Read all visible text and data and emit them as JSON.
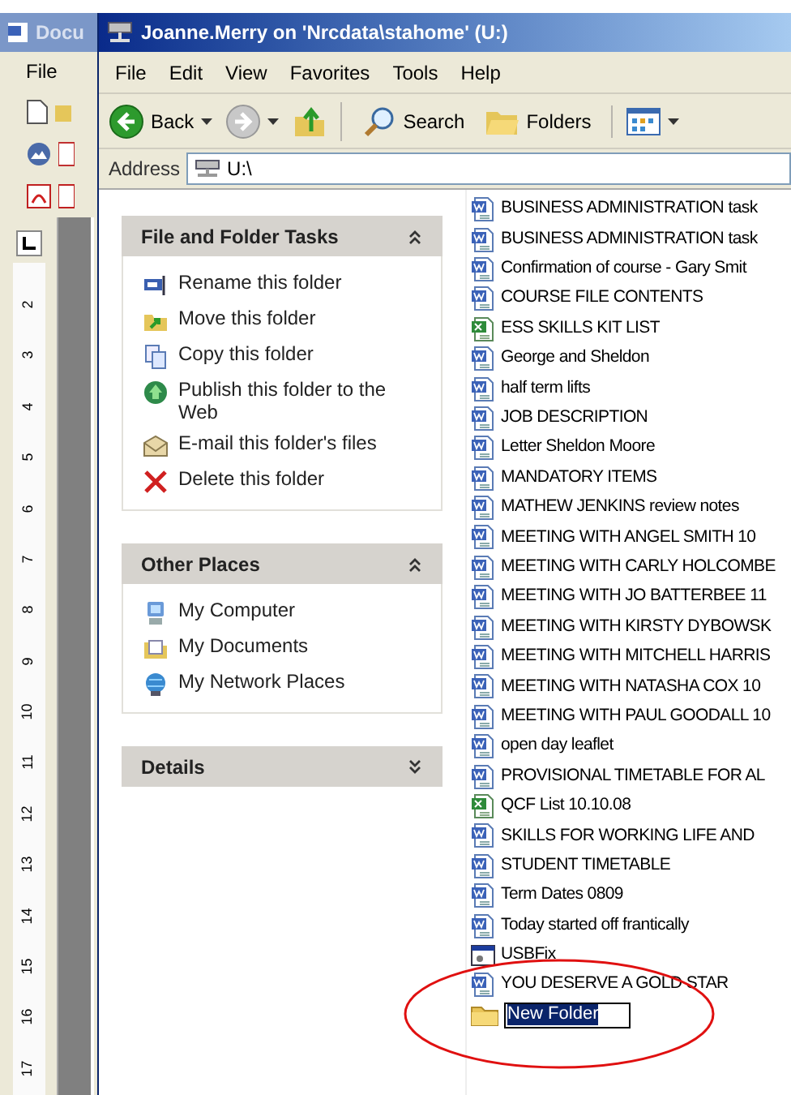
{
  "background_window": {
    "title": "Docu",
    "menu": [
      "File"
    ],
    "ruler_marks": [
      "2",
      "3",
      "4",
      "5",
      "6",
      "7",
      "8",
      "9",
      "10",
      "11",
      "12",
      "13",
      "14",
      "15",
      "16",
      "17"
    ]
  },
  "window": {
    "title": "Joanne.Merry on 'Nrcdata\\stahome' (U:)"
  },
  "menu": [
    "File",
    "Edit",
    "View",
    "Favorites",
    "Tools",
    "Help"
  ],
  "toolbar": [
    {
      "kind": "back",
      "label": "Back"
    },
    {
      "kind": "forward"
    },
    {
      "kind": "up"
    },
    {
      "kind": "search",
      "label": "Search"
    },
    {
      "kind": "folders",
      "label": "Folders"
    },
    {
      "kind": "views"
    }
  ],
  "address": {
    "label": "Address",
    "value": "U:\\"
  },
  "task_panes": [
    {
      "title": "File and Folder Tasks",
      "expanded": true,
      "items": [
        {
          "label": "Rename this folder",
          "kind": "rename"
        },
        {
          "label": "Move this folder",
          "kind": "move"
        },
        {
          "label": "Copy this folder",
          "kind": "copy"
        },
        {
          "label": "Publish this folder to the Web",
          "kind": "publish"
        },
        {
          "label": "E-mail this folder's files",
          "kind": "email"
        },
        {
          "label": "Delete this folder",
          "kind": "delete"
        }
      ]
    },
    {
      "title": "Other Places",
      "expanded": true,
      "items": [
        {
          "label": "My Computer",
          "kind": "computer"
        },
        {
          "label": "My Documents",
          "kind": "documents"
        },
        {
          "label": "My Network Places",
          "kind": "network"
        }
      ]
    },
    {
      "title": "Details",
      "expanded": false
    }
  ],
  "files": [
    {
      "name": "BUSINESS ADMINISTRATION task",
      "kind": "word",
      "editing": false
    },
    {
      "name": "BUSINESS ADMINISTRATION task",
      "kind": "word",
      "editing": false
    },
    {
      "name": "Confirmation of course - Gary Smit",
      "kind": "word",
      "editing": false
    },
    {
      "name": "COURSE FILE CONTENTS",
      "kind": "word",
      "editing": false
    },
    {
      "name": "ESS SKILLS KIT LIST",
      "kind": "excel",
      "editing": false
    },
    {
      "name": "George and Sheldon",
      "kind": "word",
      "editing": false
    },
    {
      "name": "half term lifts",
      "kind": "word",
      "editing": false
    },
    {
      "name": "JOB DESCRIPTION",
      "kind": "word",
      "editing": false
    },
    {
      "name": "Letter Sheldon Moore",
      "kind": "word",
      "editing": false
    },
    {
      "name": "MANDATORY ITEMS",
      "kind": "word",
      "editing": false
    },
    {
      "name": "MATHEW JENKINS review notes",
      "kind": "word",
      "editing": false
    },
    {
      "name": "MEETING WITH ANGEL SMITH 10",
      "kind": "word",
      "editing": false
    },
    {
      "name": "MEETING WITH CARLY HOLCOMBE",
      "kind": "word",
      "editing": false
    },
    {
      "name": "MEETING WITH JO BATTERBEE 11",
      "kind": "word",
      "editing": false
    },
    {
      "name": "MEETING WITH KIRSTY DYBOWSK",
      "kind": "word",
      "editing": false
    },
    {
      "name": "MEETING WITH MITCHELL HARRIS",
      "kind": "word",
      "editing": false
    },
    {
      "name": "MEETING WITH NATASHA COX 10",
      "kind": "word",
      "editing": false
    },
    {
      "name": "MEETING WITH PAUL GOODALL 10",
      "kind": "word",
      "editing": false
    },
    {
      "name": "open day leaflet",
      "kind": "word",
      "editing": false
    },
    {
      "name": "PROVISIONAL TIMETABLE FOR AL",
      "kind": "word",
      "editing": false
    },
    {
      "name": "QCF List 10.10.08",
      "kind": "excel",
      "editing": false
    },
    {
      "name": "SKILLS FOR WORKING LIFE AND",
      "kind": "word",
      "editing": false
    },
    {
      "name": "STUDENT TIMETABLE",
      "kind": "word",
      "editing": false
    },
    {
      "name": "Term Dates 0809",
      "kind": "word",
      "editing": false
    },
    {
      "name": "Today started off frantically",
      "kind": "word",
      "editing": false
    },
    {
      "name": "USBFix",
      "kind": "exe",
      "editing": false
    },
    {
      "name": "YOU DESERVE A GOLD STAR",
      "kind": "word",
      "editing": false
    },
    {
      "name": "New Folder",
      "kind": "folder",
      "editing": true
    }
  ]
}
